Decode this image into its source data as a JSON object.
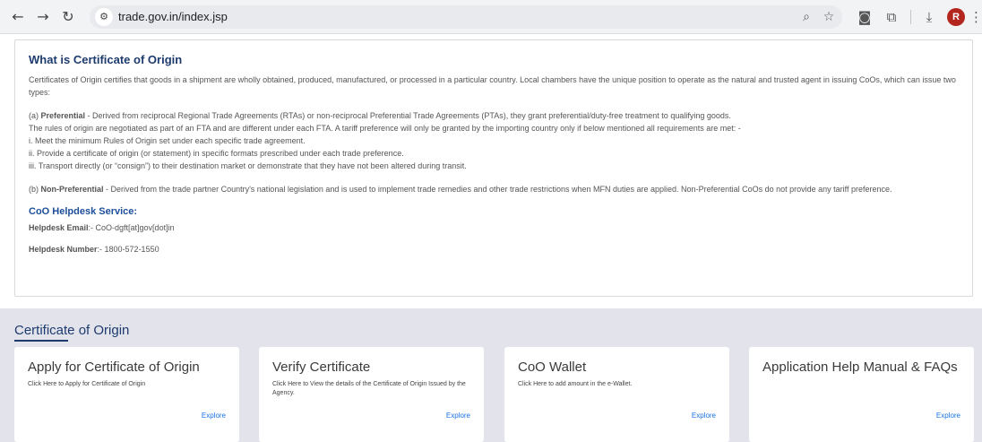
{
  "browser": {
    "url": "trade.gov.in/index.jsp",
    "avatar_letter": "R",
    "icons": [
      "back-arrow-icon",
      "forward-arrow-icon",
      "reload-icon",
      "site-info-icon",
      "zoom-icon",
      "bookmark-star-icon",
      "screenshot-icon",
      "extensions-icon",
      "download-icon",
      "profile-avatar",
      "kebab-menu-icon"
    ]
  },
  "info": {
    "title": "What is Certificate of Origin",
    "intro": "Certificates of Origin certifies that goods in a shipment are wholly obtained, produced, manufactured, or processed in a particular country. Local chambers have the unique position to operate as the natural and trusted agent in issuing CoOs, which can issue two types:",
    "preferential_label": "Preferential",
    "preferential_prefix": "(a) ",
    "preferential_text": " - Derived from reciprocal Regional Trade Agreements (RTAs) or non-reciprocal Preferential Trade Agreements (PTAs), they grant preferential/duty-free treatment to qualifying goods.",
    "rules_line": "The rules of origin are negotiated as part of an FTA and are different under each FTA. A tariff preference will only be granted by the importing country only if below mentioned all requirements are met: -",
    "req_1": "i. Meet the minimum Rules of Origin set under each specific trade agreement.",
    "req_2": "ii. Provide a certificate of origin (or statement) in specific formats prescribed under each trade preference.",
    "req_3": "iii. Transport directly (or “consign”) to their destination market or demonstrate that they have not been altered during transit.",
    "nonpref_prefix": "(b) ",
    "nonpref_label": "Non-Preferential",
    "nonpref_text": " - Derived from the trade partner Country's national legislation and is used to implement trade remedies and other trade restrictions when MFN duties are applied. Non-Preferential CoOs do not provide any tariff preference.",
    "helpdesk_title": "CoO Helpdesk Service:",
    "email_label": "Helpdesk Email",
    "email_value": ":- CoO-dgft[at]gov[dot]in",
    "number_label": "Helpdesk Number",
    "number_value": ":- 1800-572-1550"
  },
  "section": {
    "title": "Certificate of Origin",
    "cards": [
      {
        "title": "Apply for Certificate of Origin",
        "desc": "Click Here to Apply for Certificate of Origin",
        "link": "Explore"
      },
      {
        "title": "Verify Certificate",
        "desc": "Click Here to View the details of the Certificate of Origin Issued by the Agency.",
        "link": "Explore"
      },
      {
        "title": "CoO Wallet",
        "desc": "Click Here to add amount in the e-Wallet.",
        "link": "Explore"
      },
      {
        "title": "Application Help Manual & FAQs",
        "desc": "",
        "link": "Explore"
      }
    ]
  }
}
